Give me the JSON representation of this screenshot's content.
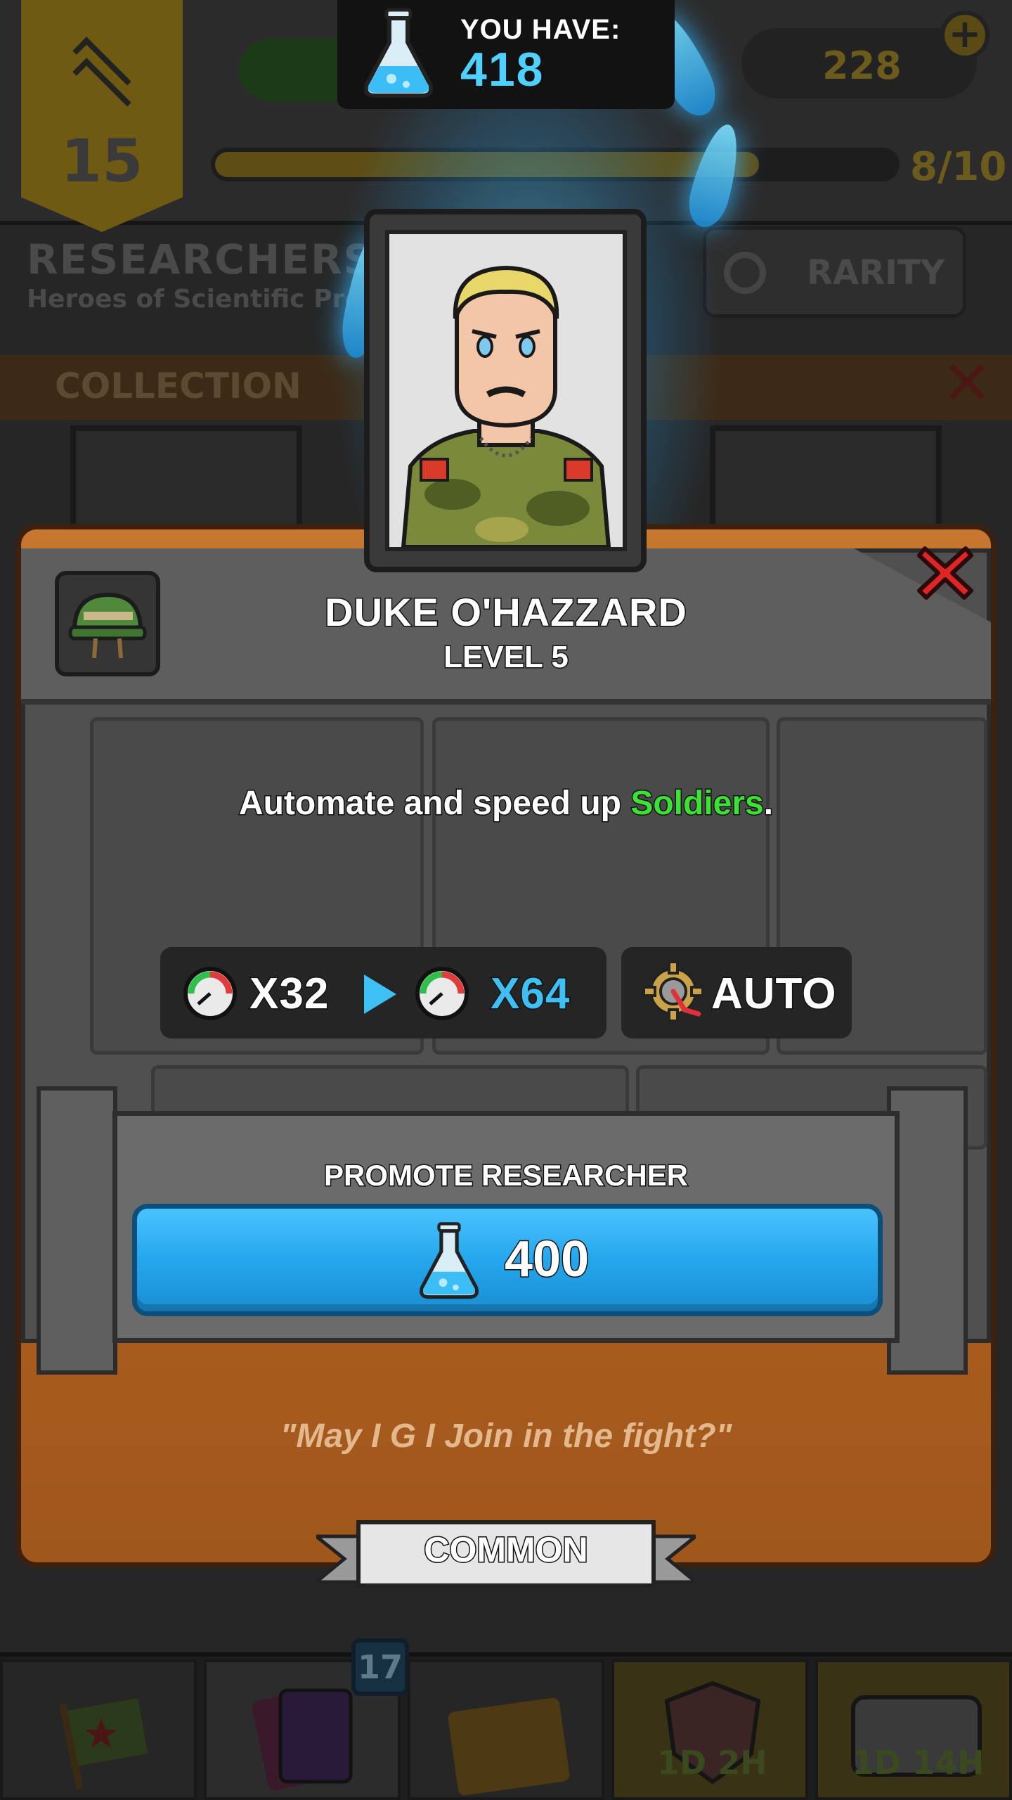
{
  "background": {
    "rank_level": "15",
    "section_title": "RESEARCHERS",
    "section_subtitle": "Heroes of Scientific Pro",
    "resource_value": "228",
    "xp_progress": "8/10",
    "xp_fraction": 0.8,
    "rarity_button": "RARITY",
    "collection_label": "COLLECTION",
    "nav_badge": "17",
    "nav_timers": [
      "1D 2H",
      "1D 14H"
    ]
  },
  "currency": {
    "label": "YOU HAVE:",
    "value": "418",
    "icon": "flask-icon"
  },
  "researcher": {
    "name": "DUKE O'HAZZARD",
    "level": "LEVEL 5",
    "description_prefix": "Automate and speed up ",
    "description_highlight": "Soldiers",
    "description_suffix": ".",
    "speed_current": "X32",
    "speed_next": "X64",
    "ability": "AUTO",
    "quote": "\"May I G I Join in the fight?\"",
    "rarity": "COMMON"
  },
  "promote": {
    "label": "PROMOTE RESEARCHER",
    "cost": "400"
  },
  "colors": {
    "accent_blue": "#4fd0ff",
    "highlight_green": "#3be234",
    "close_red": "#e02525",
    "panel_wood": "#b1621f"
  }
}
